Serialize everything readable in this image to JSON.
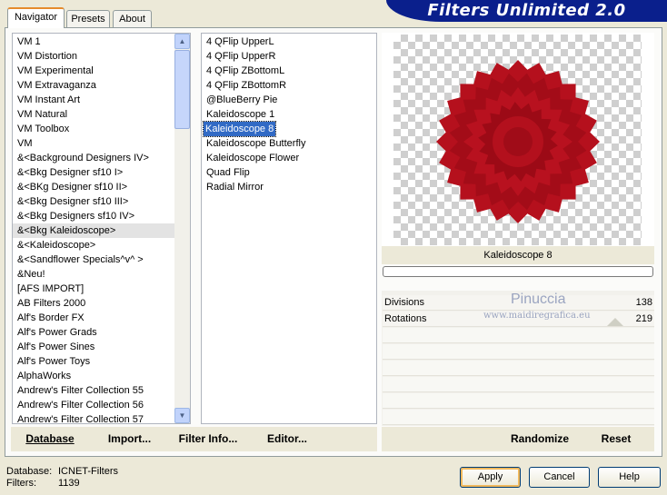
{
  "banner": {
    "title": "Filters Unlimited 2.0"
  },
  "tabs": [
    {
      "label": "Navigator",
      "active": true
    },
    {
      "label": "Presets",
      "active": false
    },
    {
      "label": "About",
      "active": false
    }
  ],
  "categories": [
    "VM 1",
    "VM Distortion",
    "VM Experimental",
    "VM Extravaganza",
    "VM Instant Art",
    "VM Natural",
    "VM Toolbox",
    "VM",
    "&<Background Designers IV>",
    "&<Bkg Designer sf10 I>",
    "&<BKg Designer sf10 II>",
    "&<Bkg Designer sf10 III>",
    "&<Bkg Designers sf10 IV>",
    "&<Bkg Kaleidoscope>",
    "&<Kaleidoscope>",
    "&<Sandflower Specials^v^ >",
    "&Neu!",
    "[AFS IMPORT]",
    "AB Filters 2000",
    "Alf's Border FX",
    "Alf's Power Grads",
    "Alf's Power Sines",
    "Alf's Power Toys",
    "AlphaWorks",
    "Andrew's Filter Collection 55",
    "Andrew's Filter Collection 56",
    "Andrew's Filter Collection 57"
  ],
  "selected_category_index": 13,
  "filters": [
    "4 QFlip UpperL",
    "4 QFlip UpperR",
    "4 QFlip ZBottomL",
    "4 QFlip ZBottomR",
    "@BlueBerry Pie",
    "Kaleidoscope 1",
    "Kaleidoscope 8",
    "Kaleidoscope Butterfly",
    "Kaleidoscope Flower",
    "Quad Flip",
    "Radial Mirror"
  ],
  "selected_filter_index": 6,
  "preview": {
    "filter_name": "Kaleidoscope 8",
    "progress": 0
  },
  "params": [
    {
      "name": "Divisions",
      "value": "138"
    },
    {
      "name": "Rotations",
      "value": "219"
    }
  ],
  "watermark": {
    "line1": "Pinuccia",
    "line2": "www.maidiregrafica.eu"
  },
  "toolbar": {
    "database": "Database",
    "import": "Import...",
    "filter_info": "Filter Info...",
    "editor": "Editor...",
    "randomize": "Randomize",
    "reset": "Reset"
  },
  "status": {
    "database_label": "Database:",
    "database_value": "ICNET-Filters",
    "filters_label": "Filters:",
    "filters_value": "1139"
  },
  "buttons": {
    "apply": "Apply",
    "cancel": "Cancel",
    "help": "Help"
  },
  "colors": {
    "accent": "#0a1f8c",
    "selection": "#316ac5",
    "preview_red": "#b5101d"
  }
}
